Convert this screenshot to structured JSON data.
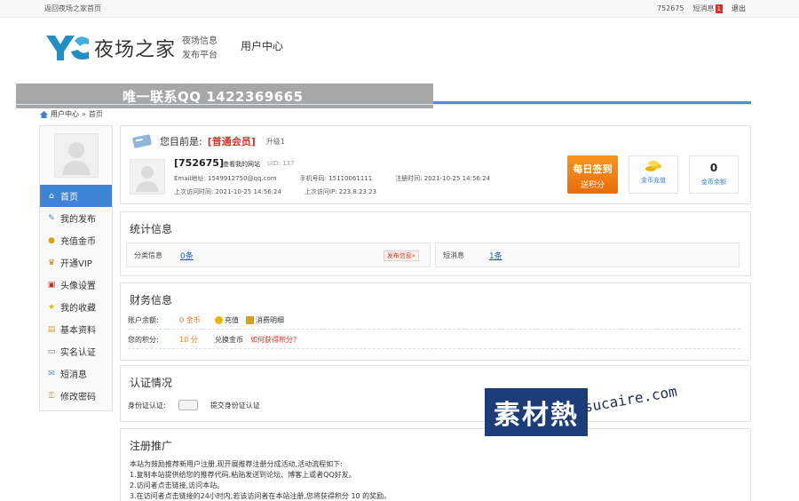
{
  "topbar": {
    "home_link": "返回夜场之家首页",
    "user_id": "752675",
    "messages": "短消息",
    "message_count": "1",
    "logout": "退出"
  },
  "header": {
    "logo_text": "夜场之家",
    "logo_sub1": "夜场信息",
    "logo_sub2": "发布平台",
    "title": "用户中心",
    "contact_banner": "唯一联系QQ 1422369665"
  },
  "breadcrumb": {
    "items": [
      "用户中心",
      "首页"
    ]
  },
  "sidebar": {
    "items": [
      {
        "label": "首页",
        "icon": "home-icon"
      },
      {
        "label": "我的发布",
        "icon": "edit-icon"
      },
      {
        "label": "充值金币",
        "icon": "coin-icon"
      },
      {
        "label": "开通VIP",
        "icon": "vip-icon"
      },
      {
        "label": "头像设置",
        "icon": "avatar-icon"
      },
      {
        "label": "我的收藏",
        "icon": "star-icon"
      },
      {
        "label": "基本资料",
        "icon": "profile-icon"
      },
      {
        "label": "实名认证",
        "icon": "id-card-icon"
      },
      {
        "label": "短消息",
        "icon": "message-icon"
      },
      {
        "label": "修改密码",
        "icon": "key-icon"
      }
    ]
  },
  "profile": {
    "prefix": "您目前是:",
    "level": "[普通会员]",
    "upgrade": "升级1",
    "user_id": "[752675]",
    "view_site": "查看我的网站",
    "uid": "UID: 137",
    "email_label": "Email地址: 1549912750@qq.com",
    "phone_label": "手机号码: 15110061111",
    "reg_time": "注册时间: 2021-10-25 14:56:24",
    "last_visit": "上次访问时间: 2021-10-25 14:56:24",
    "last_ip": "上次访问IP: 223.8.23.23",
    "sign_in": "每日签到",
    "sign_in_sub": "送积分",
    "recharge": "金币充值",
    "balance_value": "0",
    "balance_label": "金币余额"
  },
  "stats": {
    "title": "统计信息",
    "classified_label": "分类信息",
    "classified_value": "0条",
    "post_button": "发布信息»",
    "messages_label": "短消息",
    "messages_value": "1条"
  },
  "finance": {
    "title": "财务信息",
    "balance_label": "账户余额:",
    "balance_value": "0 金币",
    "recharge": "充值",
    "consume": "消费明细",
    "points_label": "您的积分:",
    "points_value": "10 分",
    "exchange": "兑换金币",
    "how_points": "如何获得积分?"
  },
  "cert": {
    "title": "认证情况",
    "id_label": "身份证认证:",
    "submit": "提交身份证认证"
  },
  "promo": {
    "title": "注册推广",
    "line1": "本站为鼓励推荐新用户注册,现开展推荐注册分成活动,活动流程如下:",
    "line2": "1.复制本站提供给您的推荐代码,粘贴发送到论坛、博客上或者QQ好友。",
    "line3": "2.访问者点击链接,访问本站。",
    "line4": "3.在访问者点击链接的24小时内,若该访问者在本站注册,您将获得积分 10 的奖励。"
  },
  "watermark": {
    "brand": "素材熱",
    "url": "sucaire.com"
  },
  "colors": {
    "accent": "#3d84d4",
    "orange": "#ea6d0c",
    "red": "#d9322b"
  }
}
